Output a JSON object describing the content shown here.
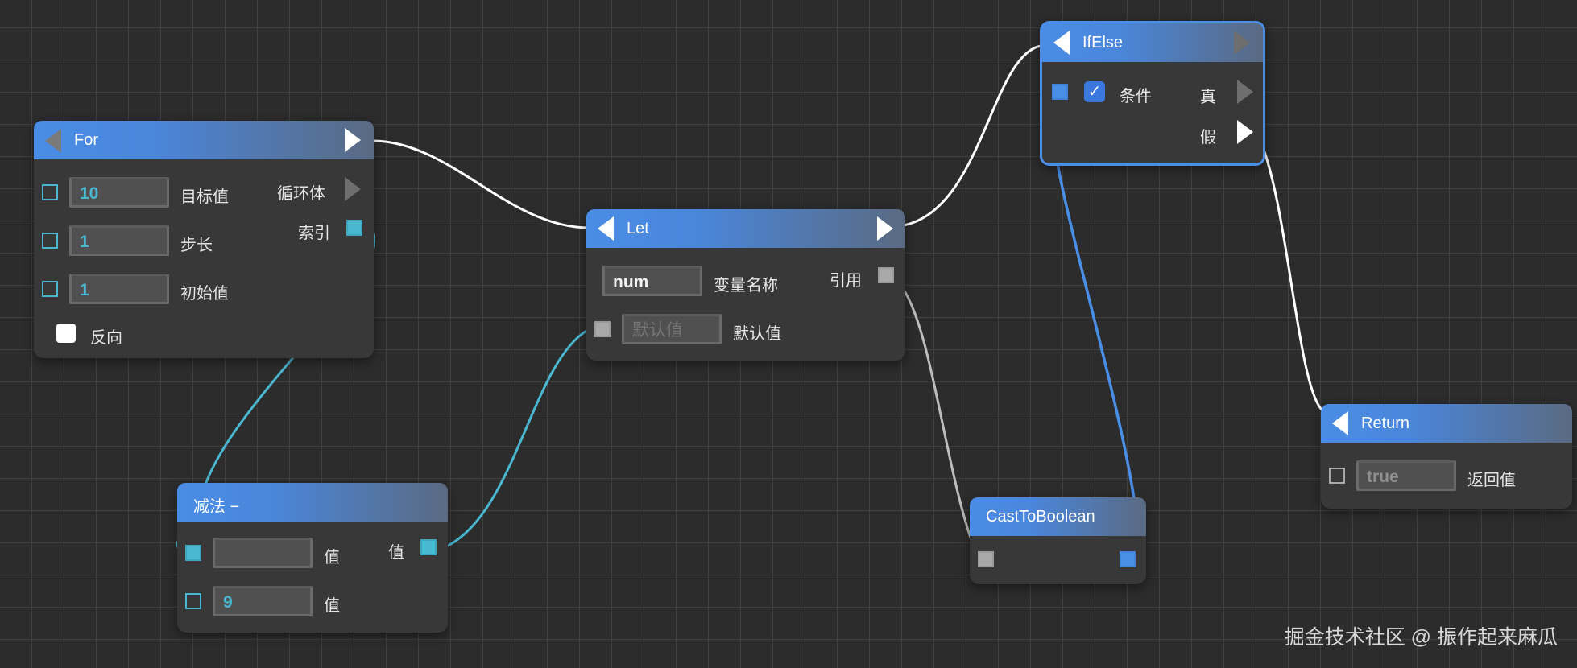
{
  "nodes": {
    "for": {
      "title": "For",
      "target_value": "10",
      "target_label": "目标值",
      "step_value": "1",
      "step_label": "步长",
      "initial_value": "1",
      "initial_label": "初始值",
      "reverse_label": "反向",
      "loop_body_label": "循环体",
      "index_label": "索引"
    },
    "let": {
      "title": "Let",
      "var_name_value": "num",
      "var_name_label": "变量名称",
      "reference_label": "引用",
      "default_placeholder": "默认值",
      "default_label": "默认值"
    },
    "ifelse": {
      "title": "IfElse",
      "condition_label": "条件",
      "true_label": "真",
      "false_label": "假",
      "condition_checked": true
    },
    "subtract": {
      "title": "减法 −",
      "first_value": "",
      "first_label": "值",
      "second_value": "9",
      "second_label": "值",
      "output_label": "值"
    },
    "cast": {
      "title": "CastToBoolean"
    },
    "return": {
      "title": "Return",
      "value": "true",
      "value_label": "返回值"
    }
  },
  "watermark": "掘金技术社区 @ 振作起来麻瓜",
  "colors": {
    "header_blue": "#4a8de6",
    "teal_port": "#4ab8d0",
    "grey_port": "#a9a9a9",
    "selection_border": "#4a8fe7",
    "canvas_bg": "#2c2c2c"
  }
}
